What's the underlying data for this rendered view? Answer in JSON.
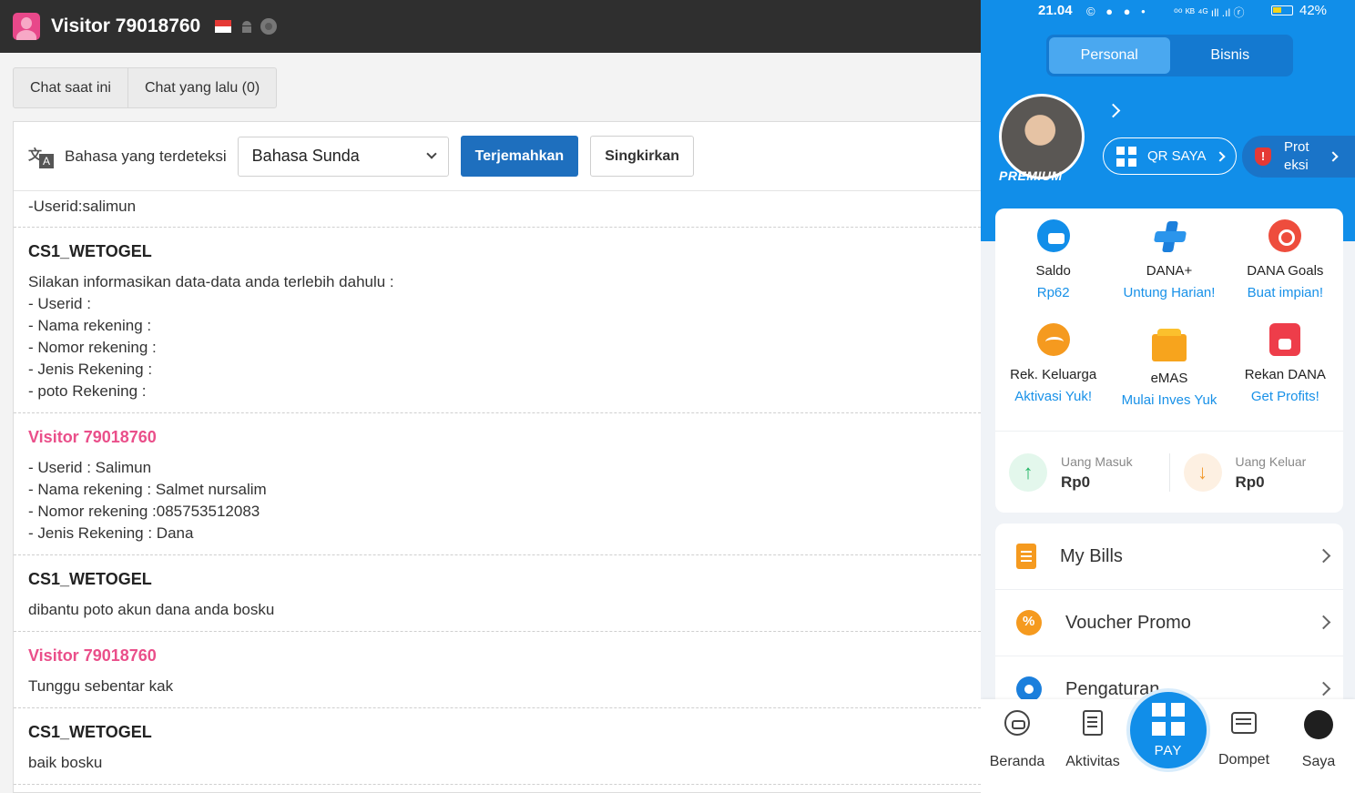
{
  "header": {
    "visitor_name": "Visitor 79018760"
  },
  "tabs": [
    {
      "label": "Chat saat ini"
    },
    {
      "label": "Chat yang lalu (0)"
    }
  ],
  "translate": {
    "label": "Bahasa yang terdeteksi",
    "selected_language": "Bahasa Sunda",
    "translate_button": "Terjemahkan",
    "dismiss_button": "Singkirkan"
  },
  "messages": {
    "first_line": "-Userid:salimun",
    "m1": {
      "sender": "CS1_WETOGEL",
      "lines": [
        "Silakan informasikan data-data anda terlebih dahulu :",
        "- Userid :",
        "- Nama rekening :",
        "- Nomor rekening :",
        "- Jenis Rekening :",
        "- poto Rekening :"
      ]
    },
    "m2": {
      "sender": "Visitor 79018760",
      "lines": [
        "- Userid : Salimun",
        "- Nama rekening : Salmet nursalim",
        "- Nomor rekening :085753512083",
        "- Jenis Rekening : Dana"
      ]
    },
    "m3": {
      "sender": "CS1_WETOGEL",
      "lines": [
        "dibantu poto akun dana anda bosku"
      ]
    },
    "m4": {
      "sender": "Visitor 79018760",
      "lines": [
        "Tunggu sebentar kak"
      ]
    },
    "m5": {
      "sender": "CS1_WETOGEL",
      "lines": [
        "baik bosku"
      ]
    }
  },
  "phone": {
    "status": {
      "time": "21.04",
      "icons": "© ● ● •",
      "signal": "⁰⁰ ᴷᴮ ⁴ᴳ ıll .ıl ⓡ",
      "battery_pct": "42%",
      "battery_level": 0.42
    },
    "segment": {
      "personal": "Personal",
      "bisnis": "Bisnis"
    },
    "premium_label": "PREMIUM",
    "qr_label": "QR SAYA",
    "protect_label": "Prot eksi",
    "menu": [
      {
        "title": "Saldo",
        "sub": "Rp62"
      },
      {
        "title": "DANA+",
        "sub": "Untung Harian!"
      },
      {
        "title": "DANA Goals",
        "sub": "Buat impian!"
      },
      {
        "title": "Rek. Keluarga",
        "sub": "Aktivasi Yuk!"
      },
      {
        "title": "eMAS",
        "sub": "Mulai Inves Yuk"
      },
      {
        "title": "Rekan DANA",
        "sub": "Get Profits!"
      }
    ],
    "money": {
      "in_label": "Uang Masuk",
      "in_value": "Rp0",
      "out_label": "Uang Keluar",
      "out_value": "Rp0"
    },
    "list": [
      {
        "label": "My Bills"
      },
      {
        "label": "Voucher Promo"
      },
      {
        "label": "Pengaturan"
      }
    ],
    "nav": {
      "home": "Beranda",
      "activity": "Aktivitas",
      "pay": "PAY",
      "wallet": "Dompet",
      "me": "Saya"
    }
  },
  "colors": {
    "dana_blue": "#118ee9",
    "visitor_pink": "#ea4f8a",
    "translate_blue": "#1e6fbe"
  }
}
